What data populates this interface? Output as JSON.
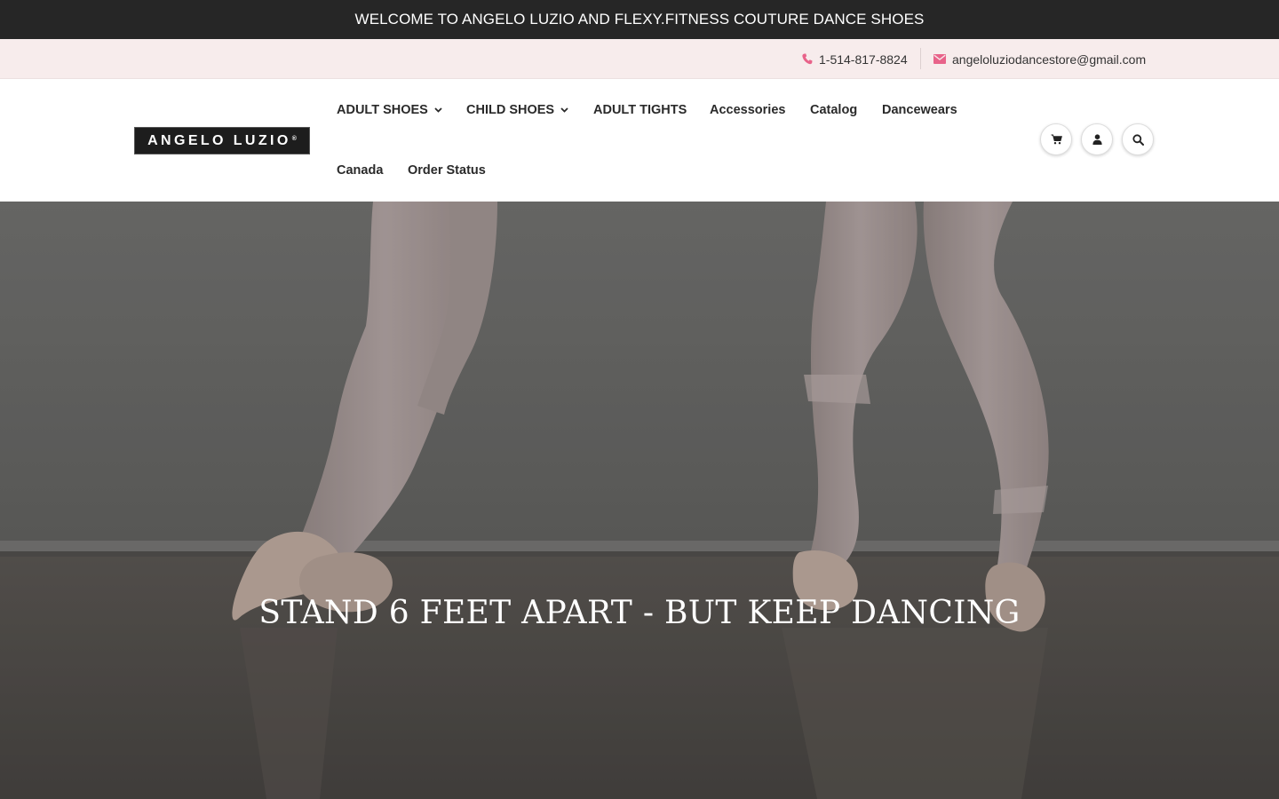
{
  "announcement": "WELCOME TO ANGELO LUZIO AND FLEXY.FITNESS COUTURE DANCE SHOES",
  "contact": {
    "phone": "1-514-817-8824",
    "email": "angeloluziodancestore@gmail.com",
    "phone_icon": "phone-icon",
    "email_icon": "envelope-icon",
    "icon_color": "#e8638a"
  },
  "logo": {
    "text": "ANGELO LUZIO",
    "mark": "®"
  },
  "nav": {
    "adult_shoes": "ADULT SHOES",
    "child_shoes": "CHILD SHOES",
    "adult_tights": "ADULT TIGHTS",
    "accessories": "Accessories",
    "catalog": "Catalog",
    "dancewears": "Dancewears",
    "canada": "Canada",
    "order_status": "Order Status"
  },
  "header_icons": [
    "cart-icon",
    "user-icon",
    "search-icon"
  ],
  "hero": {
    "title": "STAND 6 FEET APART - BUT KEEP DANCING"
  },
  "colors": {
    "announce_bg": "#262626",
    "contact_bg": "#f7ecec",
    "accent": "#e8638a"
  }
}
